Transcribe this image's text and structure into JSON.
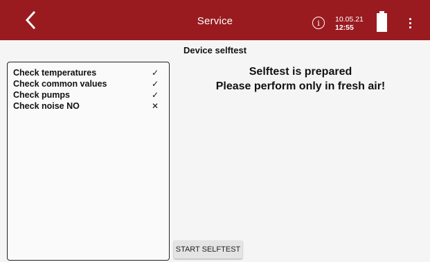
{
  "app": {
    "title": "Service",
    "accent_color": "#9a1b1f"
  },
  "header": {
    "back_icon": "chevron-left-icon",
    "info_icon": "info-circle-icon",
    "info_glyph": "i",
    "date": "10.05.21",
    "time": "12:55",
    "battery_icon": "battery-full-icon",
    "menu_icon": "more-vertical-icon"
  },
  "page": {
    "heading": "Device selftest"
  },
  "checks": [
    {
      "label": "Check temperatures",
      "status": "✓",
      "status_icon": "check-icon"
    },
    {
      "label": "Check common values",
      "status": "✓",
      "status_icon": "check-icon"
    },
    {
      "label": "Check pumps",
      "status": "✓",
      "status_icon": "check-icon"
    },
    {
      "label": "Check noise NO",
      "status": "✕",
      "status_icon": "cross-icon"
    }
  ],
  "message": {
    "line1": "Selftest is prepared",
    "line2": "Please perform only in fresh air!"
  },
  "actions": {
    "start_label": "START SELFTEST"
  }
}
